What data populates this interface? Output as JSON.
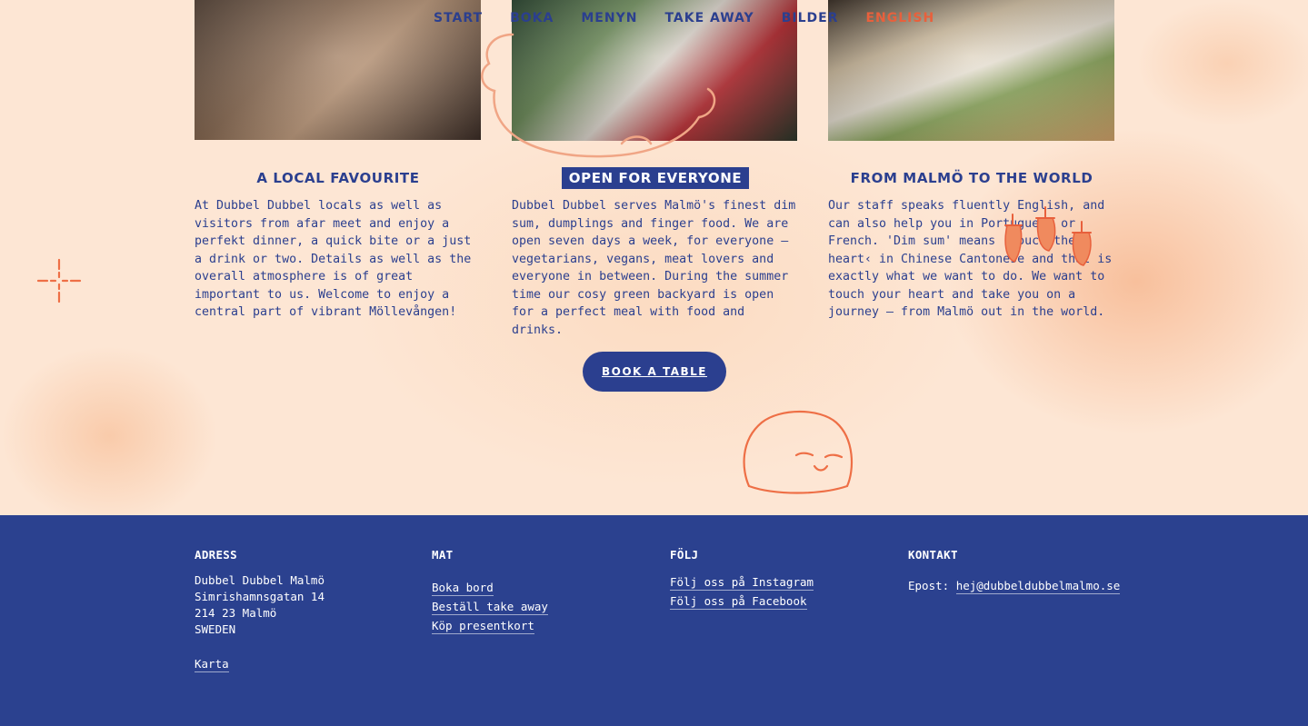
{
  "nav": {
    "items": [
      "START",
      "BOKA",
      "MENYN",
      "TAKE AWAY",
      "BILDER"
    ],
    "language": "ENGLISH"
  },
  "columns": [
    {
      "heading": "A LOCAL FAVOURITE",
      "text": "At Dubbel Dubbel locals as well as visitors from afar meet and enjoy a perfekt dinner, a quick bite or a just a drink or two. Details as well as the overall atmosphere is of great important to us. Welcome to enjoy a central part of vibrant Möllevången!"
    },
    {
      "heading": "OPEN FOR EVERYONE",
      "text": "Dubbel Dubbel serves Malmö's finest dim sum, dumplings and finger food. We are open seven days a week, for everyone – vegetarians, vegans, meat lovers and everyone in between. During the summer time our cosy green backyard is open for a perfect meal with food and drinks."
    },
    {
      "heading": "FROM MALMÖ TO THE WORLD",
      "text": "Our staff speaks fluently English, and can also help you in Portuguese or French. 'Dim sum' means ›touch the heart‹ in Chinese Cantonese and that is exactly what we want to do. We want to touch your heart and take you on a journey – from Malmö out in the world."
    }
  ],
  "cta": {
    "label": "BOOK A TABLE"
  },
  "footer": {
    "address": {
      "heading": "ADRESS",
      "lines": [
        "Dubbel Dubbel Malmö",
        "Simrishamnsgatan 14",
        "214 23 Malmö",
        "SWEDEN"
      ],
      "map_link": "Karta"
    },
    "food": {
      "heading": "MAT",
      "links": [
        "Boka bord",
        "Beställ take away",
        "Köp presentkort"
      ]
    },
    "follow": {
      "heading": "FÖLJ",
      "links": [
        "Följ oss på Instagram",
        "Följ oss på Facebook"
      ]
    },
    "contact": {
      "heading": "KONTAKT",
      "label": "Epost:",
      "email": "hej@dubbeldubbelmalmo.se"
    }
  },
  "colors": {
    "navy": "#2b3f8f",
    "accent": "#e8603c",
    "background": "#fde6d4"
  },
  "icons": [
    "cloud-doodle-icon",
    "crosshair-doodle-icon",
    "chili-doodle-icon",
    "dumpling-face-icon"
  ]
}
